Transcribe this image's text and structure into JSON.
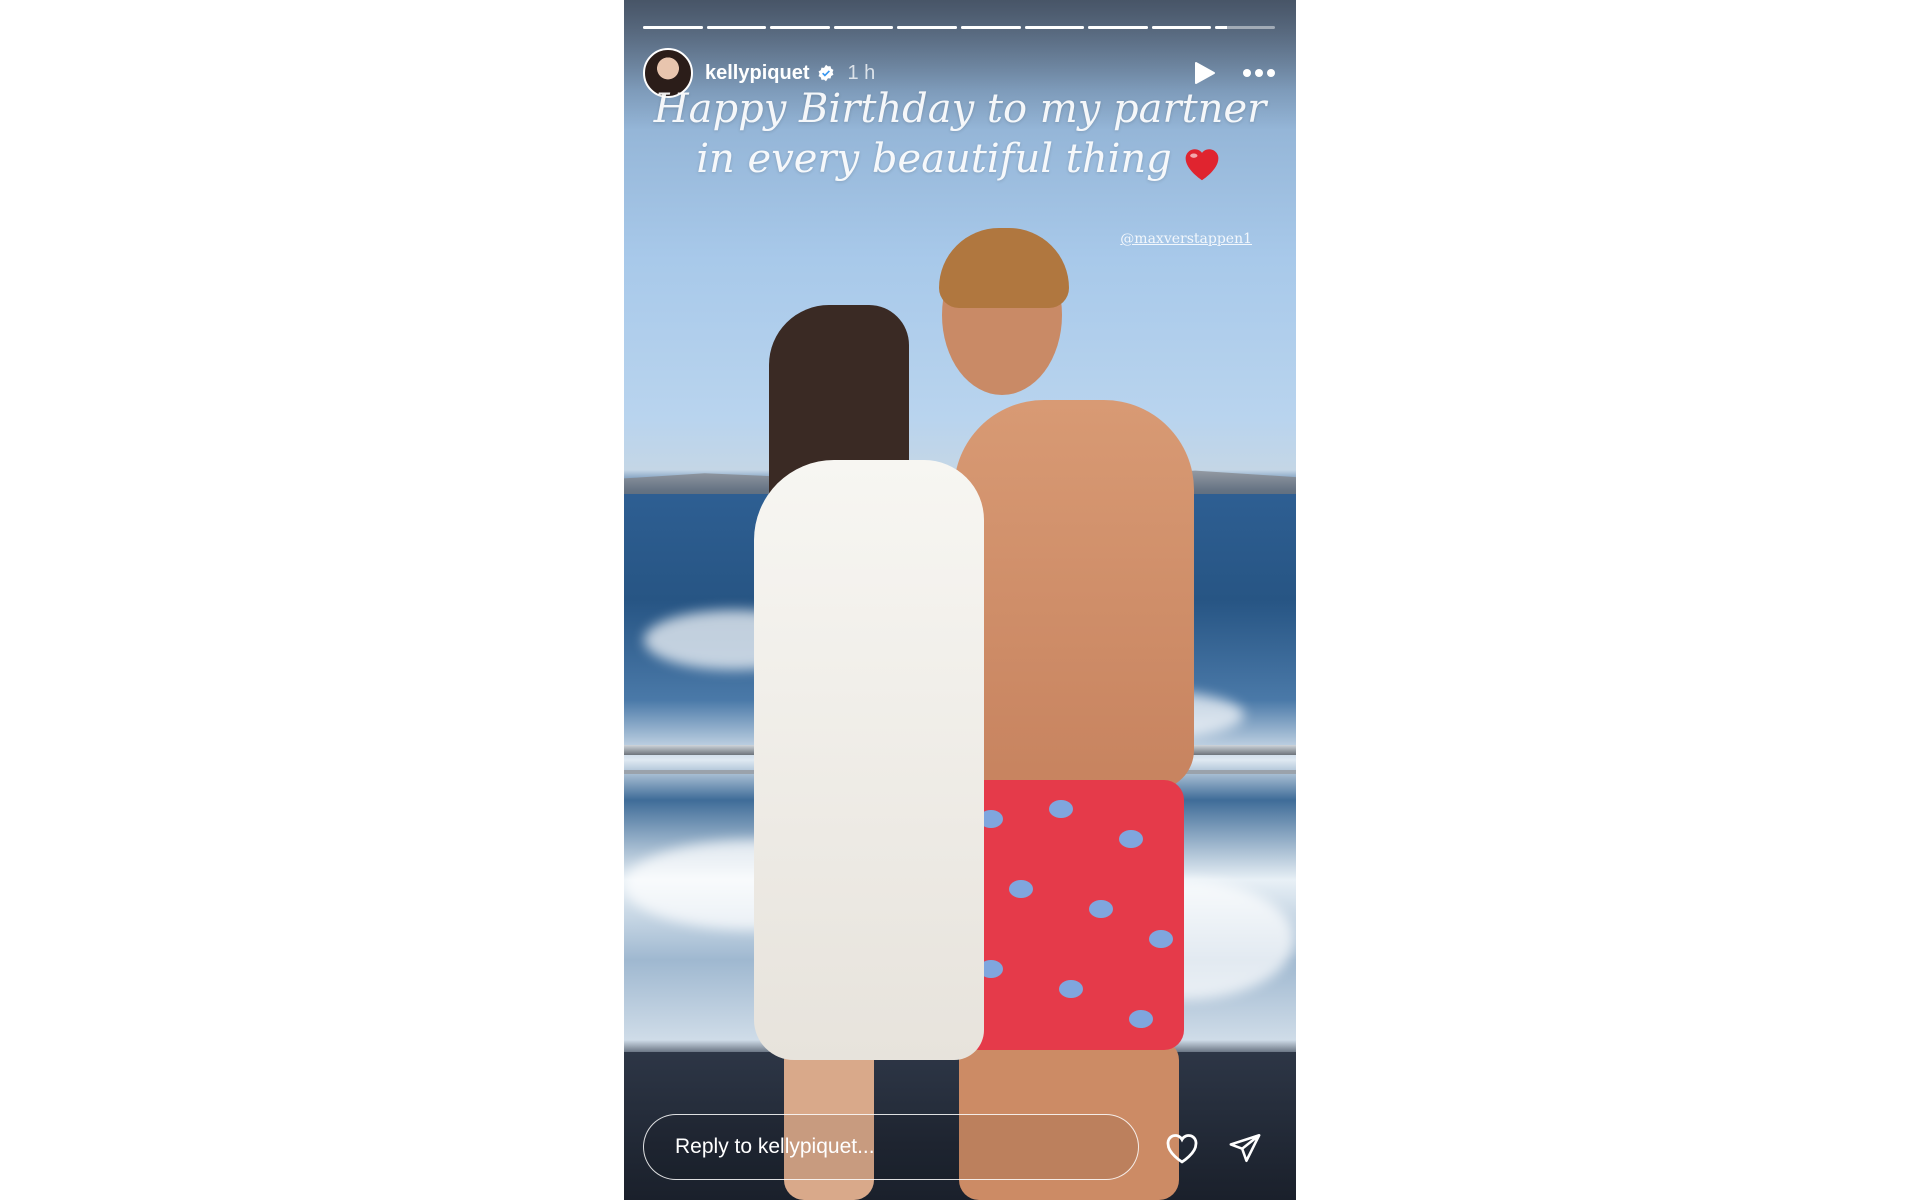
{
  "progress": {
    "segments": 10,
    "current_index": 9,
    "current_fraction": 0.2
  },
  "header": {
    "username": "kellypiquet",
    "time": "1 h",
    "verified": true,
    "icons": [
      "avatar",
      "verified-badge-icon",
      "play-icon",
      "more-options-icon"
    ]
  },
  "caption": {
    "line1": "Happy Birthday to my partner",
    "line2": "in every beautiful thing",
    "emoji": "heart"
  },
  "mention": "@maxverstappen1",
  "reply": {
    "placeholder": "Reply to kellypiquet..."
  },
  "actions": [
    "heart-icon",
    "send-icon"
  ],
  "colors": {
    "accent_heart": "#e0242f",
    "text": "#ffffff",
    "page_bg": "#ffffff"
  }
}
